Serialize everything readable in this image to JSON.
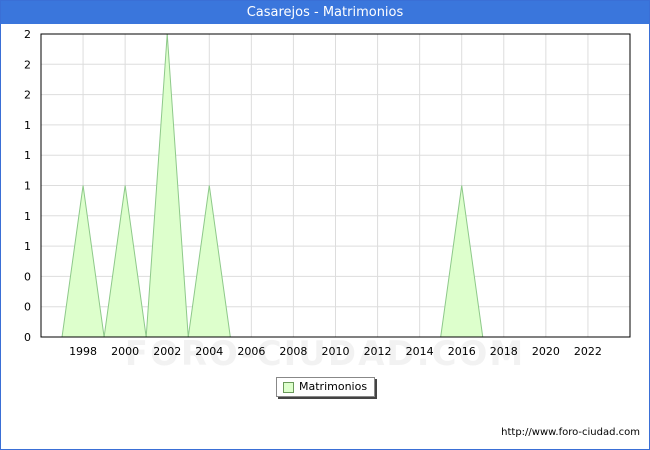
{
  "header": {
    "title": "Casarejos - Matrimonios"
  },
  "chart_data": {
    "type": "area",
    "x": [
      1997,
      1998,
      1999,
      2000,
      2001,
      2002,
      2003,
      2004,
      2005,
      2006,
      2007,
      2008,
      2009,
      2010,
      2011,
      2012,
      2013,
      2014,
      2015,
      2016,
      2017,
      2018,
      2019,
      2020,
      2021,
      2022
    ],
    "series": [
      {
        "name": "Matrimonios",
        "values": [
          0,
          1,
          0,
          1,
          0,
          2,
          0,
          1,
          0,
          0,
          0,
          0,
          0,
          0,
          0,
          0,
          0,
          0,
          0,
          1,
          0,
          0,
          0,
          0,
          0,
          0
        ]
      }
    ],
    "x_tick_labels": [
      "1998",
      "2000",
      "2002",
      "2004",
      "2006",
      "2008",
      "2010",
      "2012",
      "2014",
      "2016",
      "2018",
      "2020",
      "2022"
    ],
    "y_tick_labels": [
      "0",
      "0",
      "0",
      "1",
      "1",
      "1",
      "1",
      "1",
      "2",
      "2",
      "2"
    ],
    "xlim": [
      1996,
      2024
    ],
    "ylim": [
      0,
      2
    ],
    "grid": true,
    "legend": "bottom-center",
    "colors": {
      "fill": "#ddffcc",
      "line": "#8ec98a",
      "grid": "#dddddd",
      "axis": "#000000",
      "header": "#3a76dc"
    }
  },
  "legend": {
    "label": "Matrimonios"
  },
  "footer": {
    "url": "http://www.foro-ciudad.com"
  },
  "watermark": "FORO-CIUDAD.COM"
}
